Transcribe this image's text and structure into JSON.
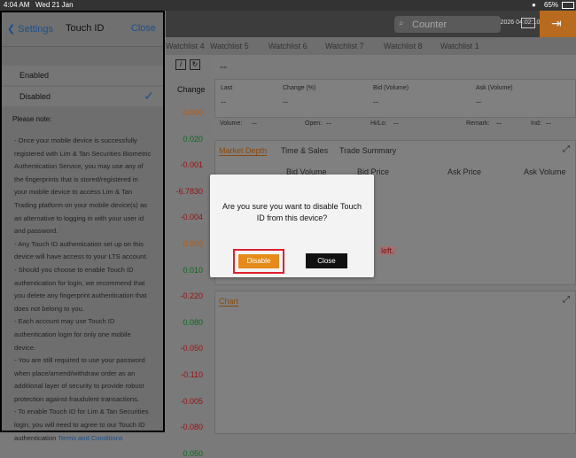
{
  "statusbar": {
    "time": "4:04 AM",
    "date": "Wed 21 Jan",
    "battery": "65%"
  },
  "header": {
    "last_login": "Last login: 21-Jan-2026 04:02:10",
    "search_placeholder": "Counter"
  },
  "tabs": [
    "Watchlist 4",
    "Watchlist 5",
    "Watchlist 6",
    "Watchlist 7",
    "Watchlist 8",
    "Watchlist 1"
  ],
  "quote_list": {
    "header": "Change",
    "values": [
      {
        "v": "0.000",
        "c": "#b65a10"
      },
      {
        "v": "0.020",
        "c": "#0b6a1b"
      },
      {
        "v": "-0.001",
        "c": "#9a1010"
      },
      {
        "v": "-6.7830",
        "c": "#9a1010"
      },
      {
        "v": "-0.004",
        "c": "#9a1010"
      },
      {
        "v": "0.000",
        "c": "#b65a10"
      },
      {
        "v": "0.010",
        "c": "#0b6a1b"
      },
      {
        "v": "-0.220",
        "c": "#9a1010"
      },
      {
        "v": "0.080",
        "c": "#0b6a1b"
      },
      {
        "v": "-0.050",
        "c": "#9a1010"
      },
      {
        "v": "-0.110",
        "c": "#9a1010"
      },
      {
        "v": "-0.005",
        "c": "#9a1010"
      },
      {
        "v": "-0.080",
        "c": "#9a1010"
      },
      {
        "v": "0.050",
        "c": "#0b6a1b"
      }
    ]
  },
  "detail": {
    "symbol": "--",
    "fields": [
      {
        "label": "Last",
        "value": "--"
      },
      {
        "label": "Change (%)",
        "value": "--"
      },
      {
        "label": "Bid (Volume)",
        "value": "--"
      },
      {
        "label": "Ask (Volume)",
        "value": "--"
      }
    ],
    "stats": [
      {
        "label": "Volume:",
        "value": "--"
      },
      {
        "label": "Open:",
        "value": "--"
      },
      {
        "label": "Hi/Lo:",
        "value": "--"
      },
      {
        "label": "Remark:",
        "value": "--"
      },
      {
        "label": "Ind:",
        "value": "--"
      }
    ],
    "depth_tabs": [
      "Market Depth",
      "Time & Sales",
      "Trade Summary"
    ],
    "depth_headers": [
      "Bid Volume",
      "Bid Price",
      "Ask Price",
      "Ask Volume"
    ],
    "left_text": "left.",
    "chart_label": "Chart"
  },
  "settings": {
    "back_label": "Settings",
    "title": "Touch ID",
    "close_label": "Close",
    "options": [
      "Enabled",
      "Disabled"
    ],
    "selected": "Disabled",
    "note_title": "Please note:",
    "notes": [
      "- Once your mobile device is successfully registered with Lim & Tan Securities Biometric Authentication Service, you may use any of the fingerprints that is stored/registered in your mobile device to access Lim & Tan Trading platform on your mobile device(s) as an alternative to logging in with your user id and password.",
      "- Any Touch ID authentication set up on this device will have access to your LTS account.",
      "- Should you choose to enable Touch ID authentication for login, we recommend that you delete any fingerprint authentication that does not belong to you.",
      "- Each account may use Touch ID authentication login for only one mobile device.",
      "- You are still required to use your password when place/amend/withdraw order as an additional layer of security to provide robust protection against fraudulent transactions.",
      "- To enable Touch ID for Lim & Tan Securities login, you will need to agree to our Touch ID authentication"
    ],
    "terms_link": "Terms and Conditions"
  },
  "dialog": {
    "message": "Are you sure you want to disable Touch ID from this device?",
    "confirm_label": "Disable",
    "cancel_label": "Close",
    "confirm_color": "#e68a19",
    "highlight_color": "#e0202e"
  }
}
